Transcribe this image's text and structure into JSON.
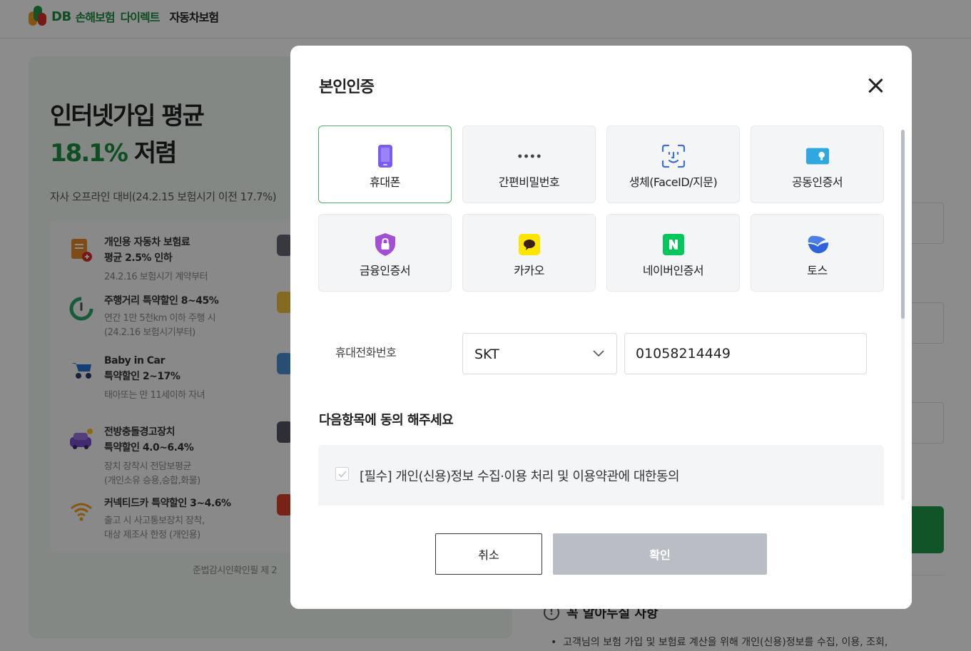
{
  "header": {
    "logo_db": "DB",
    "logo_brand": "손해보험",
    "logo_direct": "다이렉트",
    "logo_product": "자동차보험"
  },
  "promo": {
    "title_line1": "인터넷가입 평균",
    "title_rate": "18.1%",
    "title_suffix": "저렴",
    "subtitle": "자사 오프라인 대비(24.2.15 보험시기 이전 17.7%)",
    "benefits": [
      {
        "title1": "개인용 자동차 보험료",
        "title2": "평균 2.5% 인하",
        "desc1": "24.2.16 보험시기 계약부터",
        "desc2": ""
      },
      {
        "title1": "주행거리 특약할인 8~45%",
        "title2": "",
        "desc1": "연간 1만 5천km 이하 주행 시",
        "desc2": "(24.2.16 보험시기부터)"
      },
      {
        "title1": "Baby in Car",
        "title2": "특약할인 2~17%",
        "desc1": "태아또는 만 11세이하 자녀",
        "desc2": ""
      },
      {
        "title1": "전방충돌경고장치",
        "title2": "특약할인 4.0~6.4%",
        "desc1": "장치 장착시 전담보평균",
        "desc2": "(개인소유 승용,승합,화물)"
      },
      {
        "title1": "커넥티드카 특약할인 3~4.6%",
        "title2": "",
        "desc1": "출고 시 사고통보장치 장착,",
        "desc2": "대상 제조사 한정 (개인용)"
      }
    ],
    "footer": "준법감시인확인필 제 2"
  },
  "notice": {
    "icon": "!",
    "title": "꼭 알아두실 사항",
    "line1": "고객님의 보험 가입 및 보험료 계산을 위해 개인(신용)정보를 수집, 이용, 조회,"
  },
  "modal": {
    "title": "본인인증",
    "methods": [
      {
        "label": "휴대폰",
        "icon": "phone-icon",
        "selected": true
      },
      {
        "label": "간편비밀번호",
        "icon": "dots-icon",
        "selected": false
      },
      {
        "label": "생체(FaceID/지문)",
        "icon": "face-id-icon",
        "selected": false
      },
      {
        "label": "공동인증서",
        "icon": "certificate-icon",
        "selected": false
      },
      {
        "label": "금융인증서",
        "icon": "shield-lock-icon",
        "selected": false
      },
      {
        "label": "카카오",
        "icon": "kakao-icon",
        "selected": false
      },
      {
        "label": "네이버인증서",
        "icon": "naver-icon",
        "selected": false
      },
      {
        "label": "토스",
        "icon": "toss-icon",
        "selected": false
      }
    ],
    "phone_label": "휴대전화번호",
    "carrier_value": "SKT",
    "phone_value": "01058214449",
    "agree_title": "다음항목에 동의 해주세요",
    "agree_item": "[필수] 개인(신용)정보 수집·이용 처리 및 이용약관에 대한동의",
    "cancel_label": "취소",
    "confirm_label": "확인"
  },
  "colors": {
    "brand_green": "#1b8f3f",
    "selected_border": "#4cae67",
    "confirm_disabled": "#b9bec5"
  }
}
